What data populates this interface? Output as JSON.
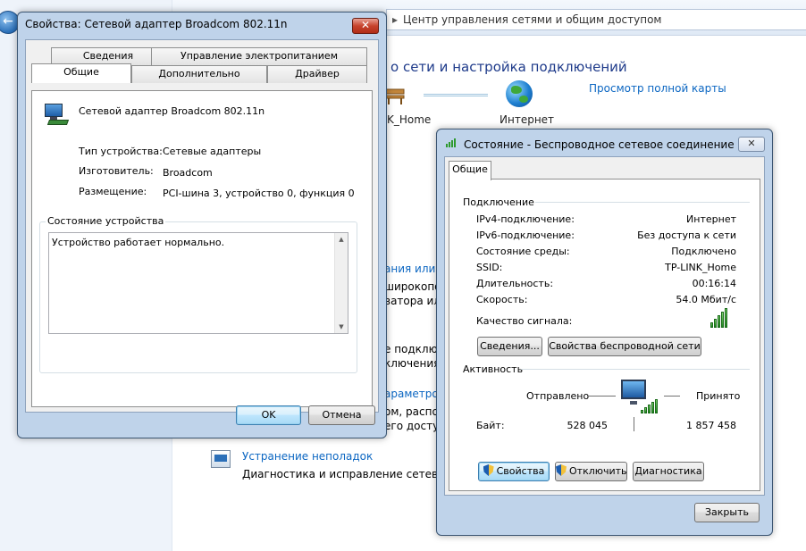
{
  "background": {
    "address_bar": "Центр управления сетями и общим доступом",
    "heading": "о сети и настройка подключений",
    "map_link": "Просмотр полной карты",
    "network_label": "K_Home",
    "internet_label": "Интернет",
    "snippets": {
      "s1": "ания или се",
      "s2": "широкопол",
      "s3": "ватора или",
      "s4": "е подключ",
      "s5": "ключения",
      "s6": "араметро",
      "s7": "ом, распол",
      "s8": "его доступа"
    },
    "troubleshoot_link": "Устранение неполадок",
    "troubleshoot_desc": "Диагностика и исправление сетевых пр"
  },
  "properties_window": {
    "title": "Свойства: Сетевой адаптер Broadcom 802.11n",
    "tabs_row1": [
      "Сведения",
      "Управление электропитанием"
    ],
    "tabs_row2": [
      "Общие",
      "Дополнительно",
      "Драйвер"
    ],
    "selected_tab": "Общие",
    "device_name": "Сетевой адаптер Broadcom 802.11n",
    "fields": {
      "type_label": "Тип устройства:",
      "type_value": "Сетевые адаптеры",
      "maker_label": "Изготовитель:",
      "maker_value": "Broadcom",
      "location_label": "Размещение:",
      "location_value": "PCI-шина 3, устройство 0, функция 0"
    },
    "status_group_label": "Состояние устройства",
    "status_text": "Устройство работает нормально.",
    "ok_button": "OK",
    "cancel_button": "Отмена"
  },
  "status_window": {
    "title": "Состояние - Беспроводное сетевое соединение",
    "tab": "Общие",
    "connection_section": "Подключение",
    "rows": [
      {
        "label": "IPv4-подключение:",
        "value": "Интернет"
      },
      {
        "label": "IPv6-подключение:",
        "value": "Без доступа к сети"
      },
      {
        "label": "Состояние среды:",
        "value": "Подключено"
      },
      {
        "label": "SSID:",
        "value": "TP-LINK_Home"
      },
      {
        "label": "Длительность:",
        "value": "00:16:14"
      },
      {
        "label": "Скорость:",
        "value": "54.0 Мбит/с"
      }
    ],
    "signal_label": "Качество сигнала:",
    "signal_bars": 5,
    "details_button": "Сведения...",
    "wireless_props_button": "Свойства беспроводной сети",
    "activity_section": "Активность",
    "sent_label": "Отправлено",
    "received_label": "Принято",
    "bytes_label": "Байт:",
    "bytes_sent": "528 045",
    "bytes_received": "1 857 458",
    "properties_button": "Свойства",
    "disconnect_button": "Отключить",
    "diagnose_button": "Диагностика",
    "close_button": "Закрыть"
  }
}
